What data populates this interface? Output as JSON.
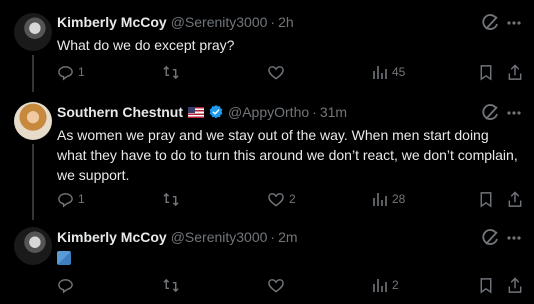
{
  "tweets": [
    {
      "name": "Kimberly McCoy",
      "handle": "@Serenity3000",
      "time": "2h",
      "text": "What do we do except pray?",
      "replies": "1",
      "retweets": "",
      "likes": "",
      "views": "45"
    },
    {
      "name": "Southern Chestnut",
      "handle": "@AppyOrtho",
      "time": "31m",
      "text": "As women we pray and we stay out of the way. When men start doing what they have to do to turn this around we don’t react, we don’t complain, we support.",
      "replies": "1",
      "retweets": "",
      "likes": "2",
      "views": "28"
    },
    {
      "name": "Kimberly McCoy",
      "handle": "@Serenity3000",
      "time": "2m",
      "text": "",
      "replies": "",
      "retweets": "",
      "likes": "",
      "views": "2"
    }
  ],
  "separator": "·",
  "colors": {
    "background": "#000000",
    "text": "#e7e9ea",
    "secondary": "#71767b",
    "verified": "#1d9bf0",
    "thread_line": "#333639"
  },
  "icons": {
    "reply": "reply-icon",
    "retweet": "retweet-icon",
    "like": "heart-icon",
    "views": "analytics-icon",
    "bookmark": "bookmark-icon",
    "share": "share-icon",
    "grok": "grok-icon",
    "more": "more-icon",
    "flag": "us-flag-icon",
    "verified": "verified-badge-icon",
    "emoji": "folded-hands-emoji"
  }
}
